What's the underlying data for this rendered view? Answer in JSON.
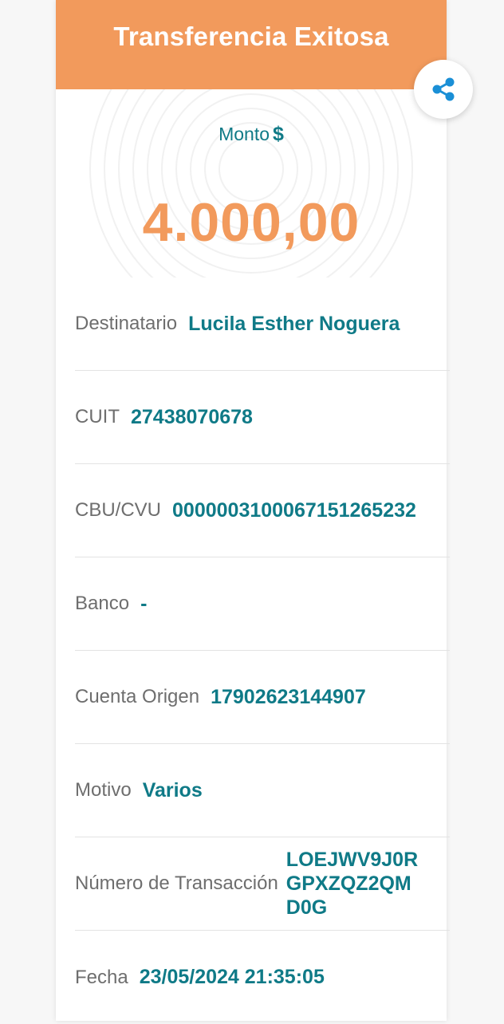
{
  "header": {
    "title": "Transferencia Exitosa",
    "color": "#f29a5c"
  },
  "share_button": {
    "icon": "share-icon"
  },
  "amount": {
    "label": "Monto",
    "currency": "$",
    "value": "4.000,00"
  },
  "details": [
    {
      "label": "Destinatario",
      "value": "Lucila Esther Noguera"
    },
    {
      "label": "CUIT",
      "value": "27438070678"
    },
    {
      "label": "CBU/CVU",
      "value": "0000003100067151265232"
    },
    {
      "label": "Banco",
      "value": "-"
    },
    {
      "label": "Cuenta Origen",
      "value": "17902623144907"
    },
    {
      "label": "Motivo",
      "value": "Varios"
    },
    {
      "label": "Número de Transacción",
      "value": "LOEJWV9J0RGPXZQZ2QMD0G"
    },
    {
      "label": "Fecha",
      "value": "23/05/2024 21:35:05"
    }
  ],
  "colors": {
    "accent": "#f29a5c",
    "value_text": "#0f7a87",
    "label_text": "#6e6e6e"
  }
}
